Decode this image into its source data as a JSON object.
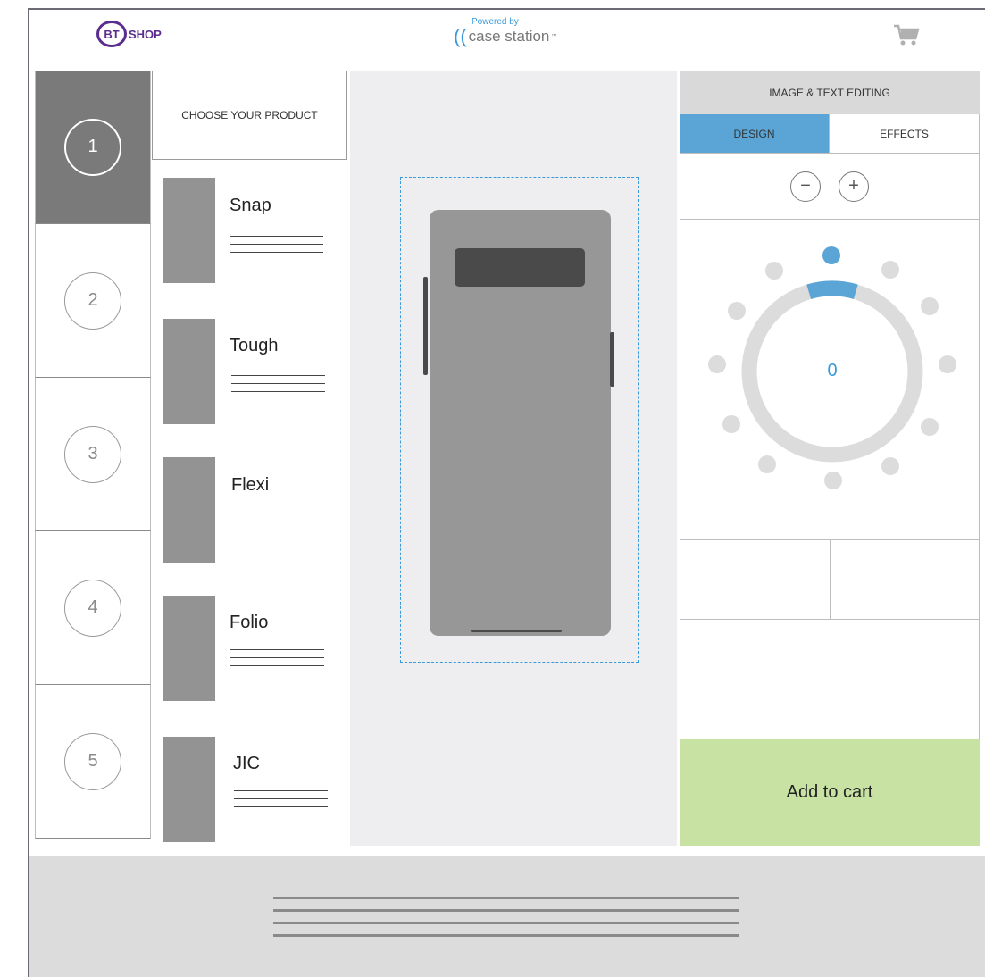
{
  "header": {
    "logo_bt": "BT",
    "logo_shop": "SHOP",
    "powered_by": "Powered by",
    "brand_name": "case station",
    "brand_tm": "™"
  },
  "steps": [
    "1",
    "2",
    "3",
    "4",
    "5"
  ],
  "active_step": "1",
  "products": {
    "title": "CHOOSE YOUR PRODUCT",
    "items": [
      {
        "label": "Snap"
      },
      {
        "label": "Tough"
      },
      {
        "label": "Flexi"
      },
      {
        "label": "Folio"
      },
      {
        "label": "JIC"
      }
    ]
  },
  "editor": {
    "title": "IMAGE & TEXT EDITING",
    "tabs": [
      {
        "label": "DESIGN",
        "active": true
      },
      {
        "label": "EFFECTS",
        "active": false
      }
    ],
    "zoom_out": "−",
    "zoom_in": "+",
    "rotation_value": "0",
    "add_to_cart": "Add to cart"
  },
  "colors": {
    "accent": "#3a9ad9",
    "tab_active": "#5aa5d6",
    "cart_button": "#c7e2a3",
    "brand": "#5b2d8e"
  },
  "icons": [
    "cart-icon",
    "minus-icon",
    "plus-icon",
    "rotation-dial-icon",
    "case-station-logo-icon"
  ]
}
